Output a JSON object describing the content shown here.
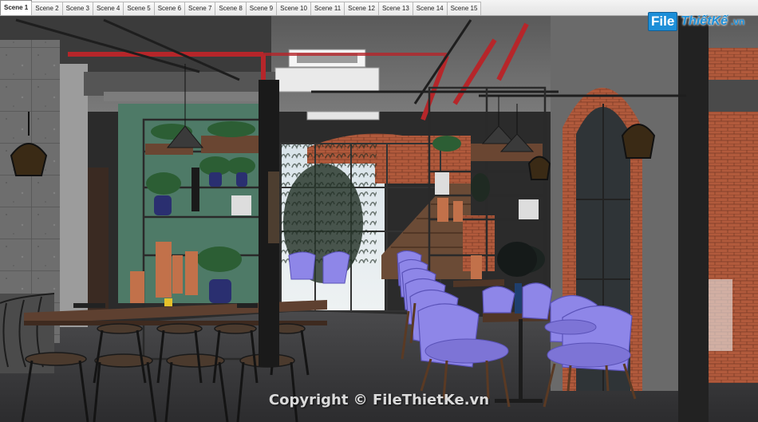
{
  "app": {
    "scenes": [
      {
        "label": "Scene 1",
        "active": true
      },
      {
        "label": "Scene 2",
        "active": false
      },
      {
        "label": "Scene 3",
        "active": false
      },
      {
        "label": "Scene 4",
        "active": false
      },
      {
        "label": "Scene 5",
        "active": false
      },
      {
        "label": "Scene 6",
        "active": false
      },
      {
        "label": "Scene 7",
        "active": false
      },
      {
        "label": "Scene 8",
        "active": false
      },
      {
        "label": "Scene 9",
        "active": false
      },
      {
        "label": "Scene 10",
        "active": false
      },
      {
        "label": "Scene 11",
        "active": false
      },
      {
        "label": "Scene 12",
        "active": false
      },
      {
        "label": "Scene 13",
        "active": false
      },
      {
        "label": "Scene 14",
        "active": false
      },
      {
        "label": "Scene 15",
        "active": false
      }
    ]
  },
  "logo": {
    "box": "File",
    "name": "ThiếtKế",
    "tld": ".vn"
  },
  "watermark": "Copyright © FileThietKe.vn",
  "colors": {
    "chair": "#8e86e8",
    "brick": "#b5583a",
    "wall_green": "#4e7a67",
    "pipe_red": "#b6262a",
    "floor": "#3c3c3e",
    "accent": "#1d8fd8"
  },
  "icons": [
    "camera-icon"
  ]
}
